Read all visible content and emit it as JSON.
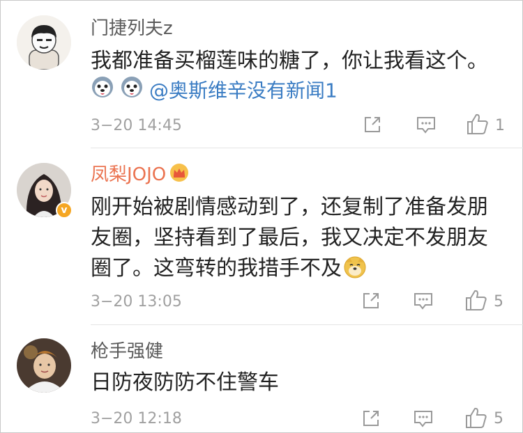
{
  "comments": [
    {
      "username": "门捷列夫z",
      "text": "我都准备买榴莲味的糖了，你让我看这个。",
      "mention": "@奥斯维辛没有新闻1",
      "time": "3−20 14:45",
      "likes": "1"
    },
    {
      "username": "凤梨JOJO",
      "verified_badge": "v",
      "text_line1": "刚开始被剧情感动到了，还复制了准备发朋",
      "text_line2": "友圈，坚持看到了最后，我又决定不发朋友",
      "text_line3": "圈了。这弯转的我措手不及",
      "time": "3−20 13:05",
      "likes": "5"
    },
    {
      "username": "枪手强健",
      "text": "日防夜防防不住警车",
      "time": "3−20 12:18",
      "likes": "5"
    }
  ],
  "icons": {
    "share": "share-icon",
    "comment": "comment-icon",
    "like": "thumb-up-icon",
    "dog_emoji": "husky-emoji-icon",
    "doge_emoji": "doge-emoji-icon",
    "crown": "crown-badge-icon"
  },
  "colors": {
    "username": "#5a5a5a",
    "vip_username": "#eb7350",
    "mention": "#3a7cc3",
    "meta": "#a0a0a0"
  }
}
